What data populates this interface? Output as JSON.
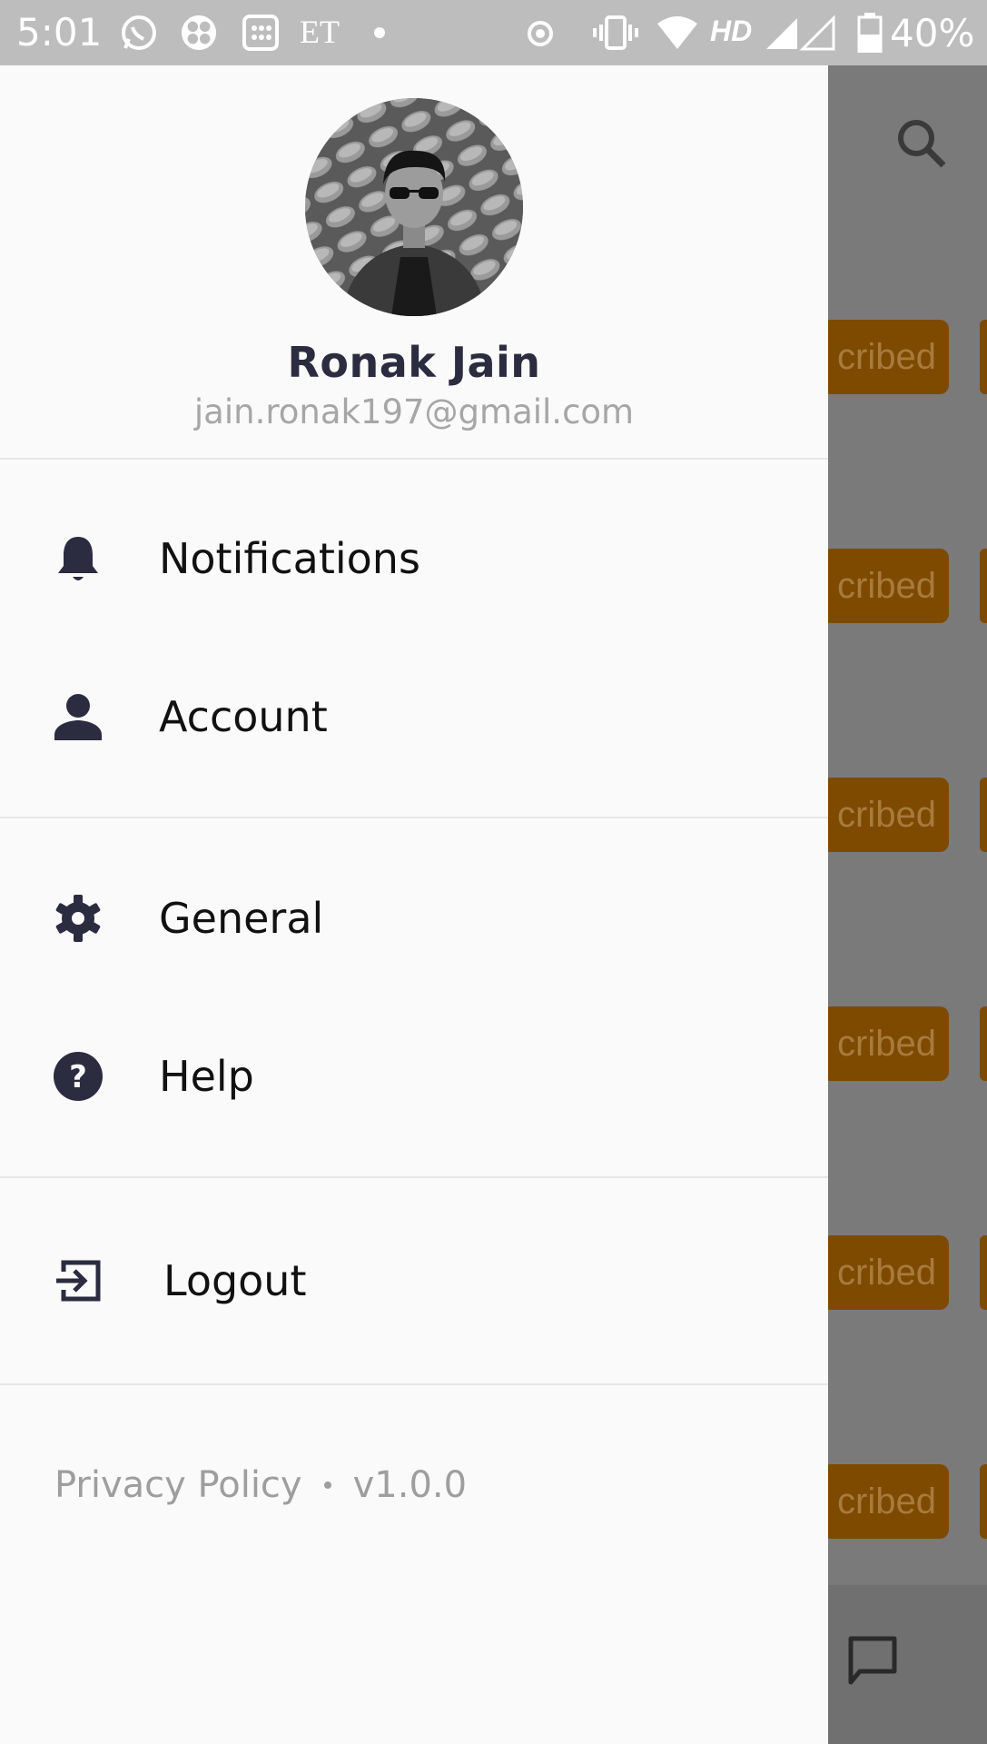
{
  "status_bar": {
    "time": "5:01",
    "carrier_label": "ET",
    "network_label": "HD",
    "battery_percent": "40%",
    "icons": [
      "whatsapp-icon",
      "pinwheel-icon",
      "calculator-icon",
      "dot-icon",
      "alarm-icon",
      "vibrate-icon",
      "wifi-icon",
      "signal-icon",
      "battery-icon"
    ]
  },
  "drawer": {
    "profile": {
      "name": "Ronak Jain",
      "email": "jain.ronak197@gmail.com"
    },
    "menu": [
      {
        "label": "Notifications",
        "icon": "bell-icon"
      },
      {
        "label": "Account",
        "icon": "person-icon"
      },
      {
        "label": "General",
        "icon": "gear-icon"
      },
      {
        "label": "Help",
        "icon": "help-icon"
      },
      {
        "label": "Logout",
        "icon": "logout-icon"
      }
    ],
    "footer": {
      "privacy_label": "Privacy Policy",
      "version": "v1.0.0"
    }
  },
  "background_app": {
    "badge_label": "cribed",
    "badge_color": "#7d4a00",
    "icons": [
      "search-icon",
      "chat-icon"
    ]
  },
  "colors": {
    "drawer_bg": "#fafafa",
    "icon_color": "#2c2c40",
    "status_bar_bg": "#bdbdbd",
    "scrim": "#7a7a7a"
  }
}
